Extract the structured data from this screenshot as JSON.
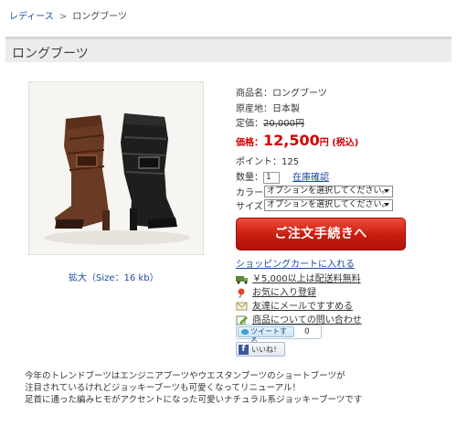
{
  "breadcrumb": {
    "category": "レディース",
    "separator": ">",
    "current": "ロングブーツ"
  },
  "page_title": "ロングブーツ",
  "image": {
    "enlarge_text": "拡大（Size：16 kb）"
  },
  "product": {
    "name_row": "商品名：ロングブーツ",
    "origin_row": "原産地：日本製",
    "list_price_label": "定価：",
    "list_price_value": "20,000円",
    "price_label": "価格：",
    "price_value": "12,500",
    "price_unit": "円 (税込)",
    "points_row": "ポイント：125",
    "qty_label": "数量：",
    "qty_value": "1",
    "stock_link": "在庫確認",
    "color_label": "カラー",
    "color_select": "オプションを選択してください。",
    "size_label": "サイズ",
    "size_select": "オプションを選択してください。"
  },
  "order_button": "ご注文手続きへ",
  "cart_link": "ショッピングカートに入れる",
  "links": {
    "shipping": "￥5,000以上は配送料無料",
    "favorite": "お気に入り登録",
    "email_friend": "友達にメールですすめる",
    "inquiry": "商品についての問い合わせ"
  },
  "tweet": {
    "label": "ツイートする",
    "count": "0"
  },
  "facebook": {
    "label": "いいね！"
  },
  "description": [
    "今年のトレンドブーツはエンジニアブーツやウエスタンブーツのショートブーツが",
    "注目されているけれどジョッキーブーツも可愛くなってリニューアル！",
    "足首に通った編みヒモがアクセントになった可愛いナチュラル系ジョッキーブーツです"
  ],
  "colors": {
    "link": "#1a4a9e",
    "price_red": "#d40000",
    "button_red": "#c81b10"
  }
}
